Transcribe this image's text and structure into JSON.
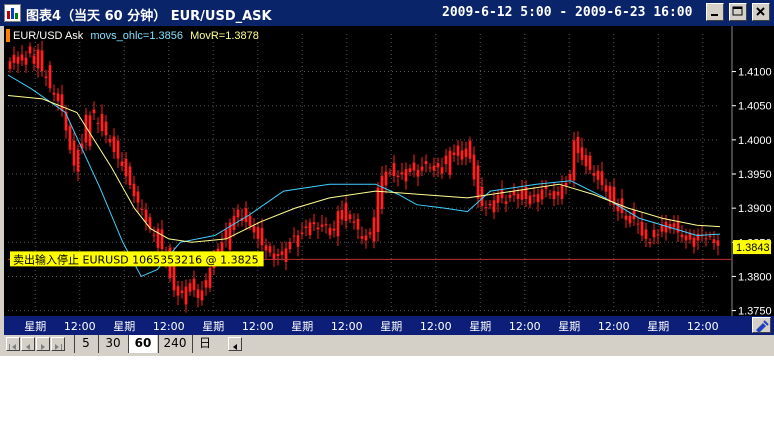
{
  "window": {
    "title": "图表4（当天 60 分钟）  EUR/USD_ASK",
    "date_range": "2009-6-12 5:00 - 2009-6-23 16:00"
  },
  "colors": {
    "titlebar": "#0a246a",
    "chart_bg": "#000000",
    "candle": "#ff2020",
    "wick": "#ff2020",
    "ma_fast": "#40d0ff",
    "ma_slow": "#ffff90",
    "grid": "#555555",
    "axis_text": "#ffffff",
    "order_line": "#c03030",
    "order_label_bg": "#ffff00",
    "price_label_bg": "#ffff00"
  },
  "chart_data": {
    "type": "candlestick",
    "instrument": "EUR/USD Ask",
    "legend": {
      "instrument": "EUR/USD Ask",
      "indicator_1": "movs_ohlc=1.3856",
      "indicator_2": "MovR=1.3878"
    },
    "ylim": [
      1.3745,
      1.4155
    ],
    "y_ticks": [
      "1.4100",
      "1.4050",
      "1.4000",
      "1.3950",
      "1.3900",
      "1.3850",
      "1.3800",
      "1.3750"
    ],
    "y_tick_values": [
      1.41,
      1.405,
      1.4,
      1.395,
      1.39,
      1.385,
      1.38,
      1.375
    ],
    "x_tick_labels": [
      "星期",
      "12:00",
      "星期",
      "12:00",
      "星期",
      "12:00",
      "星期",
      "12:00",
      "星期",
      "12:00",
      "星期",
      "12:00",
      "星期",
      "12:00",
      "星期",
      "12:00"
    ],
    "bar_count": 178,
    "close": [
      1.4115,
      1.4125,
      1.411,
      1.4128,
      1.4118,
      1.413,
      1.412,
      1.4095,
      1.4105,
      1.408,
      1.407,
      1.406,
      1.405,
      1.402,
      1.399,
      1.396,
      1.3985,
      1.3995,
      1.404,
      1.4035,
      1.404,
      1.402,
      1.401,
      1.4005,
      1.399,
      1.3975,
      1.397,
      1.395,
      1.394,
      1.392,
      1.391,
      1.39,
      1.388,
      1.387,
      1.386,
      1.384,
      1.384,
      1.382,
      1.379,
      1.3775,
      1.377,
      1.378,
      1.379,
      1.379,
      1.3765,
      1.3775,
      1.379,
      1.381,
      1.3825,
      1.384,
      1.385,
      1.387,
      1.388,
      1.389,
      1.39,
      1.388,
      1.388,
      1.387,
      1.386,
      1.385,
      1.384,
      1.3835,
      1.3835,
      1.383,
      1.383,
      1.384,
      1.385,
      1.386,
      1.386,
      1.3865,
      1.3875,
      1.388,
      1.3875,
      1.387,
      1.388,
      1.387,
      1.385,
      1.389,
      1.3905,
      1.388,
      1.3885,
      1.388,
      1.387,
      1.3855,
      1.386,
      1.3865,
      1.389,
      1.394,
      1.395,
      1.3955,
      1.395,
      1.3945,
      1.395,
      1.3955,
      1.396,
      1.3955,
      1.3955,
      1.396,
      1.3965,
      1.396,
      1.3955,
      1.396,
      1.396,
      1.398,
      1.3985,
      1.398,
      1.3975,
      1.399,
      1.3985,
      1.396,
      1.392,
      1.3905,
      1.39,
      1.3905,
      1.391,
      1.392,
      1.3915,
      1.391,
      1.392,
      1.3925,
      1.392,
      1.391,
      1.3915,
      1.392,
      1.3915,
      1.3925,
      1.393,
      1.3925,
      1.391,
      1.392,
      1.3935,
      1.393,
      1.3945,
      1.4,
      1.398,
      1.397,
      1.396,
      1.3955,
      1.3945,
      1.394,
      1.393,
      1.392,
      1.39,
      1.391,
      1.39,
      1.388,
      1.389,
      1.3885,
      1.388,
      1.386,
      1.3855,
      1.385,
      1.387,
      1.386,
      1.388,
      1.388,
      1.3875,
      1.387,
      1.386,
      1.3855,
      1.385,
      1.386,
      1.385,
      1.386,
      1.3855,
      1.386,
      1.3855,
      1.3845
    ],
    "ma_fast_points": [
      [
        0,
        1.4095
      ],
      [
        10,
        1.4075
      ],
      [
        25,
        1.404
      ],
      [
        40,
        1.393
      ],
      [
        50,
        1.385
      ],
      [
        58,
        1.38
      ],
      [
        65,
        1.381
      ],
      [
        75,
        1.385
      ],
      [
        90,
        1.386
      ],
      [
        105,
        1.389
      ],
      [
        120,
        1.3925
      ],
      [
        140,
        1.3935
      ],
      [
        150,
        1.3935
      ],
      [
        160,
        1.3935
      ],
      [
        170,
        1.392
      ],
      [
        178,
        1.3905
      ],
      [
        190,
        1.39
      ],
      [
        200,
        1.3895
      ],
      [
        210,
        1.3925
      ],
      [
        220,
        1.393
      ],
      [
        230,
        1.3935
      ],
      [
        245,
        1.394
      ],
      [
        260,
        1.3915
      ],
      [
        275,
        1.3885
      ],
      [
        290,
        1.387
      ],
      [
        300,
        1.386
      ],
      [
        310,
        1.3862
      ]
    ],
    "ma_slow_points": [
      [
        0,
        1.4065
      ],
      [
        15,
        1.406
      ],
      [
        30,
        1.404
      ],
      [
        45,
        1.396
      ],
      [
        55,
        1.39
      ],
      [
        62,
        1.387
      ],
      [
        70,
        1.3855
      ],
      [
        80,
        1.385
      ],
      [
        95,
        1.3855
      ],
      [
        110,
        1.388
      ],
      [
        125,
        1.39
      ],
      [
        140,
        1.3915
      ],
      [
        160,
        1.3925
      ],
      [
        180,
        1.392
      ],
      [
        200,
        1.3915
      ],
      [
        220,
        1.3925
      ],
      [
        240,
        1.3935
      ],
      [
        255,
        1.392
      ],
      [
        270,
        1.39
      ],
      [
        285,
        1.3885
      ],
      [
        300,
        1.3875
      ],
      [
        310,
        1.3873
      ]
    ],
    "last_price_label": "1.3843",
    "order": {
      "label": "卖出输入停止 EURUSD 1065353216 @ 1.3825",
      "price": 1.3825
    }
  },
  "tabs": {
    "items": [
      {
        "label": "5"
      },
      {
        "label": "30"
      },
      {
        "label": "60"
      },
      {
        "label": "240"
      },
      {
        "label": "日"
      }
    ],
    "active_index": 2
  },
  "icons": {
    "window_icon": "chart-window-icon",
    "minimize": "minimize-icon",
    "maximize": "maximize-icon",
    "close": "close-icon",
    "axis_tool": "axis-tool-icon"
  }
}
